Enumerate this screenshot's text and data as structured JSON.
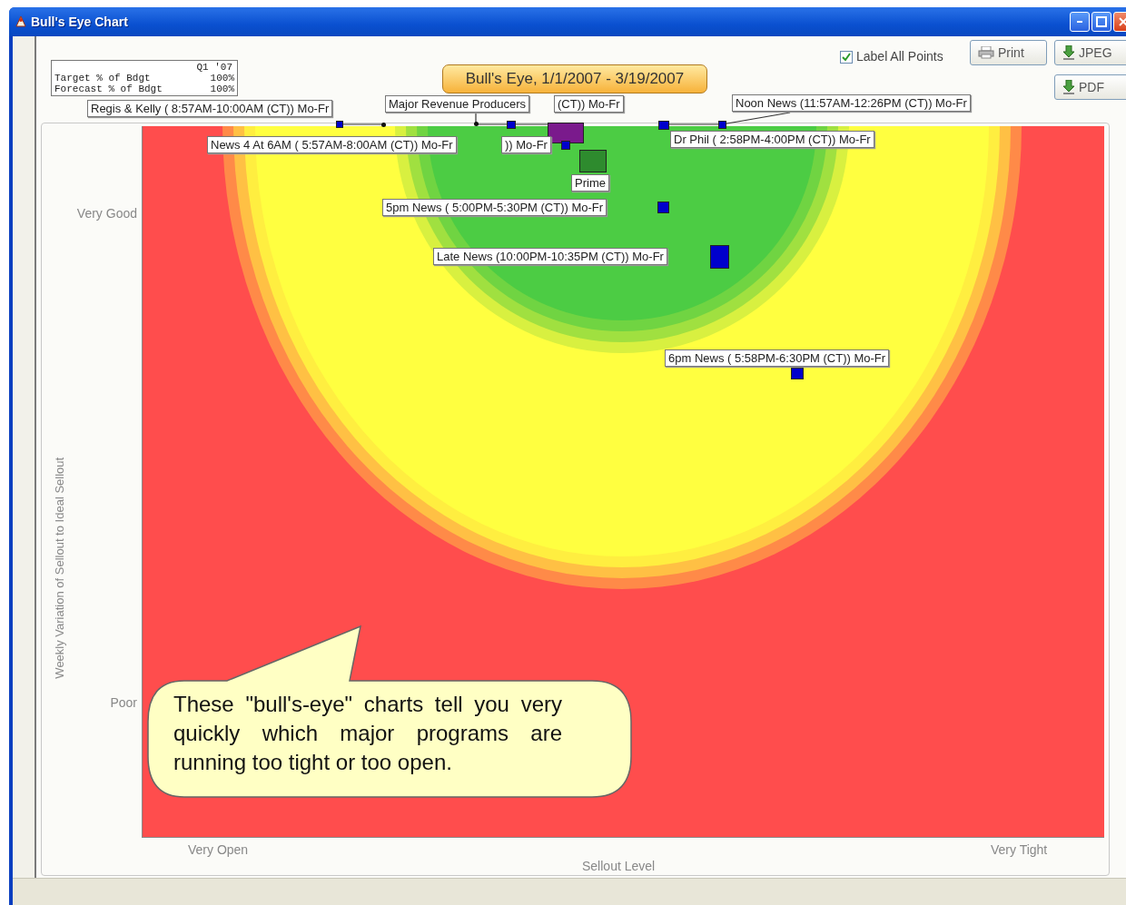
{
  "window": {
    "title": "Bull's Eye Chart"
  },
  "label_all_points": {
    "label": "Label All Points",
    "checked": true
  },
  "buttons": [
    {
      "label": "Print",
      "kind": "print"
    },
    {
      "label": "JPEG",
      "kind": "export"
    },
    {
      "label": "PDF",
      "kind": "export"
    }
  ],
  "summary": {
    "header": "Q1 '07",
    "rows": [
      {
        "label": "Target % of Bdgt",
        "value": "100%"
      },
      {
        "label": "Forecast % of Bdgt",
        "value": "100%"
      }
    ]
  },
  "chart": {
    "title": "Bull's Eye, 1/1/2007 - 3/19/2007",
    "y_axis": {
      "title": "Weekly Variation of Sellout to Ideal Sellout",
      "labels": [
        "Very Good",
        "Poor"
      ]
    },
    "x_axis": {
      "title": "Sellout Level",
      "labels": [
        "Very Open",
        "Very Tight"
      ]
    },
    "points": [
      {
        "label": "Regis & Kelly ( 8:57AM-10:00AM (CT)) Mo-Fr",
        "color": "#0000cc"
      },
      {
        "label": "Major Revenue Producers",
        "color": "#7a1a8c"
      },
      {
        "label": "(CT)) Mo-Fr",
        "color": "#0000cc"
      },
      {
        "label": "News 4 At 6AM ( 5:57AM-8:00AM (CT)) Mo-Fr",
        "color": "#0000cc"
      },
      {
        "label": ")) Mo-Fr"
      },
      {
        "label": "Noon News (11:57AM-12:26PM (CT)) Mo-Fr",
        "color": "#0000cc"
      },
      {
        "label": "Dr Phil ( 2:58PM-4:00PM (CT)) Mo-Fr",
        "color": "#0000cc"
      },
      {
        "label": "Prime",
        "color": "#2e8b2e"
      },
      {
        "label": "5pm News  ( 5:00PM-5:30PM (CT)) Mo-Fr",
        "color": "#0000cc"
      },
      {
        "label": "Late News (10:00PM-10:35PM (CT)) Mo-Fr",
        "color": "#0000cc"
      },
      {
        "label": "6pm News ( 5:58PM-6:30PM (CT)) Mo-Fr",
        "color": "#0000cc"
      }
    ],
    "callout": "These \"bull's-eye\" charts tell you very quickly which major programs are running too tight or too open."
  }
}
